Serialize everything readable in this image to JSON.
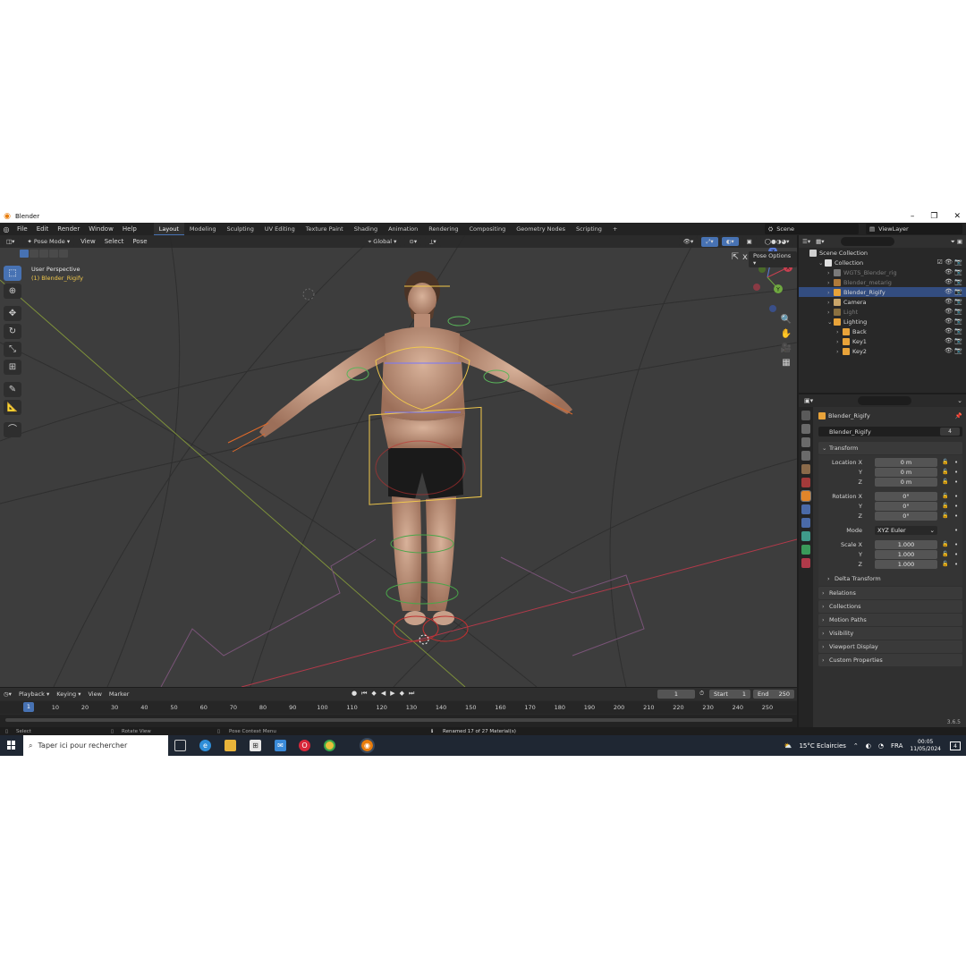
{
  "window": {
    "title": "Blender"
  },
  "menu": [
    "File",
    "Edit",
    "Render",
    "Window",
    "Help"
  ],
  "workspaces": [
    "Layout",
    "Modeling",
    "Sculpting",
    "UV Editing",
    "Texture Paint",
    "Shading",
    "Animation",
    "Rendering",
    "Compositing",
    "Geometry Nodes",
    "Scripting"
  ],
  "scene": {
    "name": "Scene",
    "view_layer": "ViewLayer"
  },
  "viewport": {
    "mode": "Pose Mode",
    "header_menus": [
      "View",
      "Select",
      "Pose"
    ],
    "orientation": "Global",
    "perspective_label": "User Perspective",
    "active_object_label": "(1) Blender_Rigify",
    "pose_options": "Pose Options",
    "gizmo_axes": [
      "Z",
      "Y",
      "X"
    ]
  },
  "outliner": {
    "root": "Scene Collection",
    "rows": [
      {
        "label": "Collection",
        "indent": 1,
        "icon_color": "#e0e0e0"
      },
      {
        "label": "WGTS_Blender_rig",
        "indent": 2,
        "icon_color": "#7a7a7a",
        "dim": true
      },
      {
        "label": "Blender_metarig",
        "indent": 2,
        "icon_color": "#b07a3a",
        "dim": true
      },
      {
        "label": "Blender_Rigify",
        "indent": 2,
        "icon_color": "#e8a33a",
        "selected": true
      },
      {
        "label": "Camera",
        "indent": 2,
        "icon_color": "#c9a56a"
      },
      {
        "label": "Light",
        "indent": 2,
        "icon_color": "#8a7040",
        "dim": true
      },
      {
        "label": "Lighting",
        "indent": 2,
        "icon_color": "#e8a33a"
      },
      {
        "label": "Back",
        "indent": 3,
        "icon_color": "#e8a33a"
      },
      {
        "label": "Key1",
        "indent": 3,
        "icon_color": "#e8a33a"
      },
      {
        "label": "Key2",
        "indent": 3,
        "icon_color": "#e8a33a"
      }
    ]
  },
  "properties": {
    "object_name": "Blender_Rigify",
    "data_name": "Blender_Rigify",
    "data_users": "4",
    "transform": {
      "title": "Transform",
      "location": {
        "label": "Location X",
        "x": "0 m",
        "y": "0 m",
        "z": "0 m"
      },
      "rotation": {
        "label": "Rotation X",
        "x": "0°",
        "y": "0°",
        "z": "0°"
      },
      "mode_label": "Mode",
      "mode_value": "XYZ Euler",
      "scale": {
        "label": "Scale X",
        "x": "1.000",
        "y": "1.000",
        "z": "1.000"
      },
      "y_label": "Y",
      "z_label": "Z",
      "delta": "Delta Transform"
    },
    "panels": [
      "Relations",
      "Collections",
      "Motion Paths",
      "Visibility",
      "Viewport Display",
      "Custom Properties"
    ],
    "version": "3.6.5"
  },
  "timeline": {
    "menus": [
      "Playback",
      "Keying",
      "View",
      "Marker"
    ],
    "current_frame": "1",
    "start_label": "Start",
    "start": "1",
    "end_label": "End",
    "end": "250",
    "ticks": [
      "10",
      "20",
      "30",
      "40",
      "50",
      "60",
      "70",
      "80",
      "90",
      "100",
      "110",
      "120",
      "130",
      "140",
      "150",
      "160",
      "170",
      "180",
      "190",
      "200",
      "210",
      "220",
      "230",
      "240",
      "250"
    ]
  },
  "statusbar": {
    "select": "Select",
    "rotate": "Rotate View",
    "context": "Pose Context Menu",
    "message": "Renamed 17 of 27 Material(s)"
  },
  "taskbar": {
    "search_placeholder": "Taper ici pour rechercher",
    "weather": "15°C  Eclaircies",
    "language": "FRA",
    "time": "00:05",
    "date": "11/05/2024",
    "notifications": "4"
  },
  "colors": {
    "accent": "#4772b3",
    "selection": "#334d80",
    "armature": "#f2c94c",
    "viewport_bg": "#3d3d3d"
  }
}
